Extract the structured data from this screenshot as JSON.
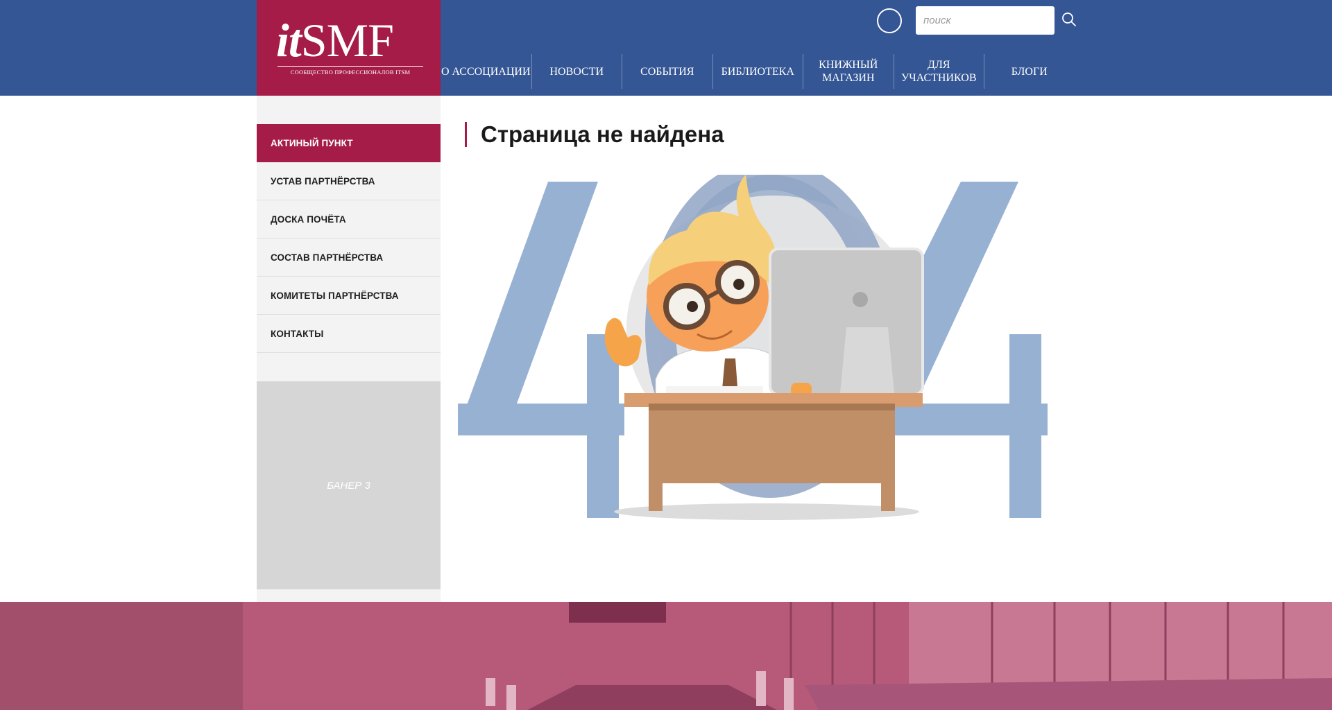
{
  "logo": {
    "main_it": "it",
    "main_smf": "SMF",
    "tagline": "СООБЩЕСТВО ПРОФЕССИОНАЛОВ ITSM"
  },
  "search": {
    "placeholder": "поиск",
    "value": ""
  },
  "nav": [
    {
      "label": "О АССОЦИАЦИИ"
    },
    {
      "label": "НОВОСТИ"
    },
    {
      "label": "СОБЫТИЯ"
    },
    {
      "label": "БИБЛИОТЕКА"
    },
    {
      "label": "КНИЖНЫЙ МАГАЗИН"
    },
    {
      "label": "ДЛЯ УЧАСТНИКОВ"
    },
    {
      "label": "БЛОГИ"
    }
  ],
  "sidebar": {
    "items": [
      {
        "label": "АКТИНЫЙ ПУНКТ",
        "active": true
      },
      {
        "label": "УСТАВ ПАРТНЁРСТВА",
        "active": false
      },
      {
        "label": "ДОСКА ПОЧЁТА",
        "active": false
      },
      {
        "label": "СОСТАВ ПАРТНЁРСТВА",
        "active": false
      },
      {
        "label": "КОМИТЕТЫ ПАРТНЁРСТВА",
        "active": false
      },
      {
        "label": "КОНТАКТЫ",
        "active": false
      }
    ],
    "banner": "БАНЕР 3"
  },
  "main": {
    "title": "Страница не найдена",
    "error_code": "404"
  },
  "colors": {
    "header": "#345694",
    "accent": "#a51c48",
    "sidebar_bg": "#f4f3f3",
    "digits": "#97b1d2",
    "footer_tint": "#b75a7a"
  }
}
